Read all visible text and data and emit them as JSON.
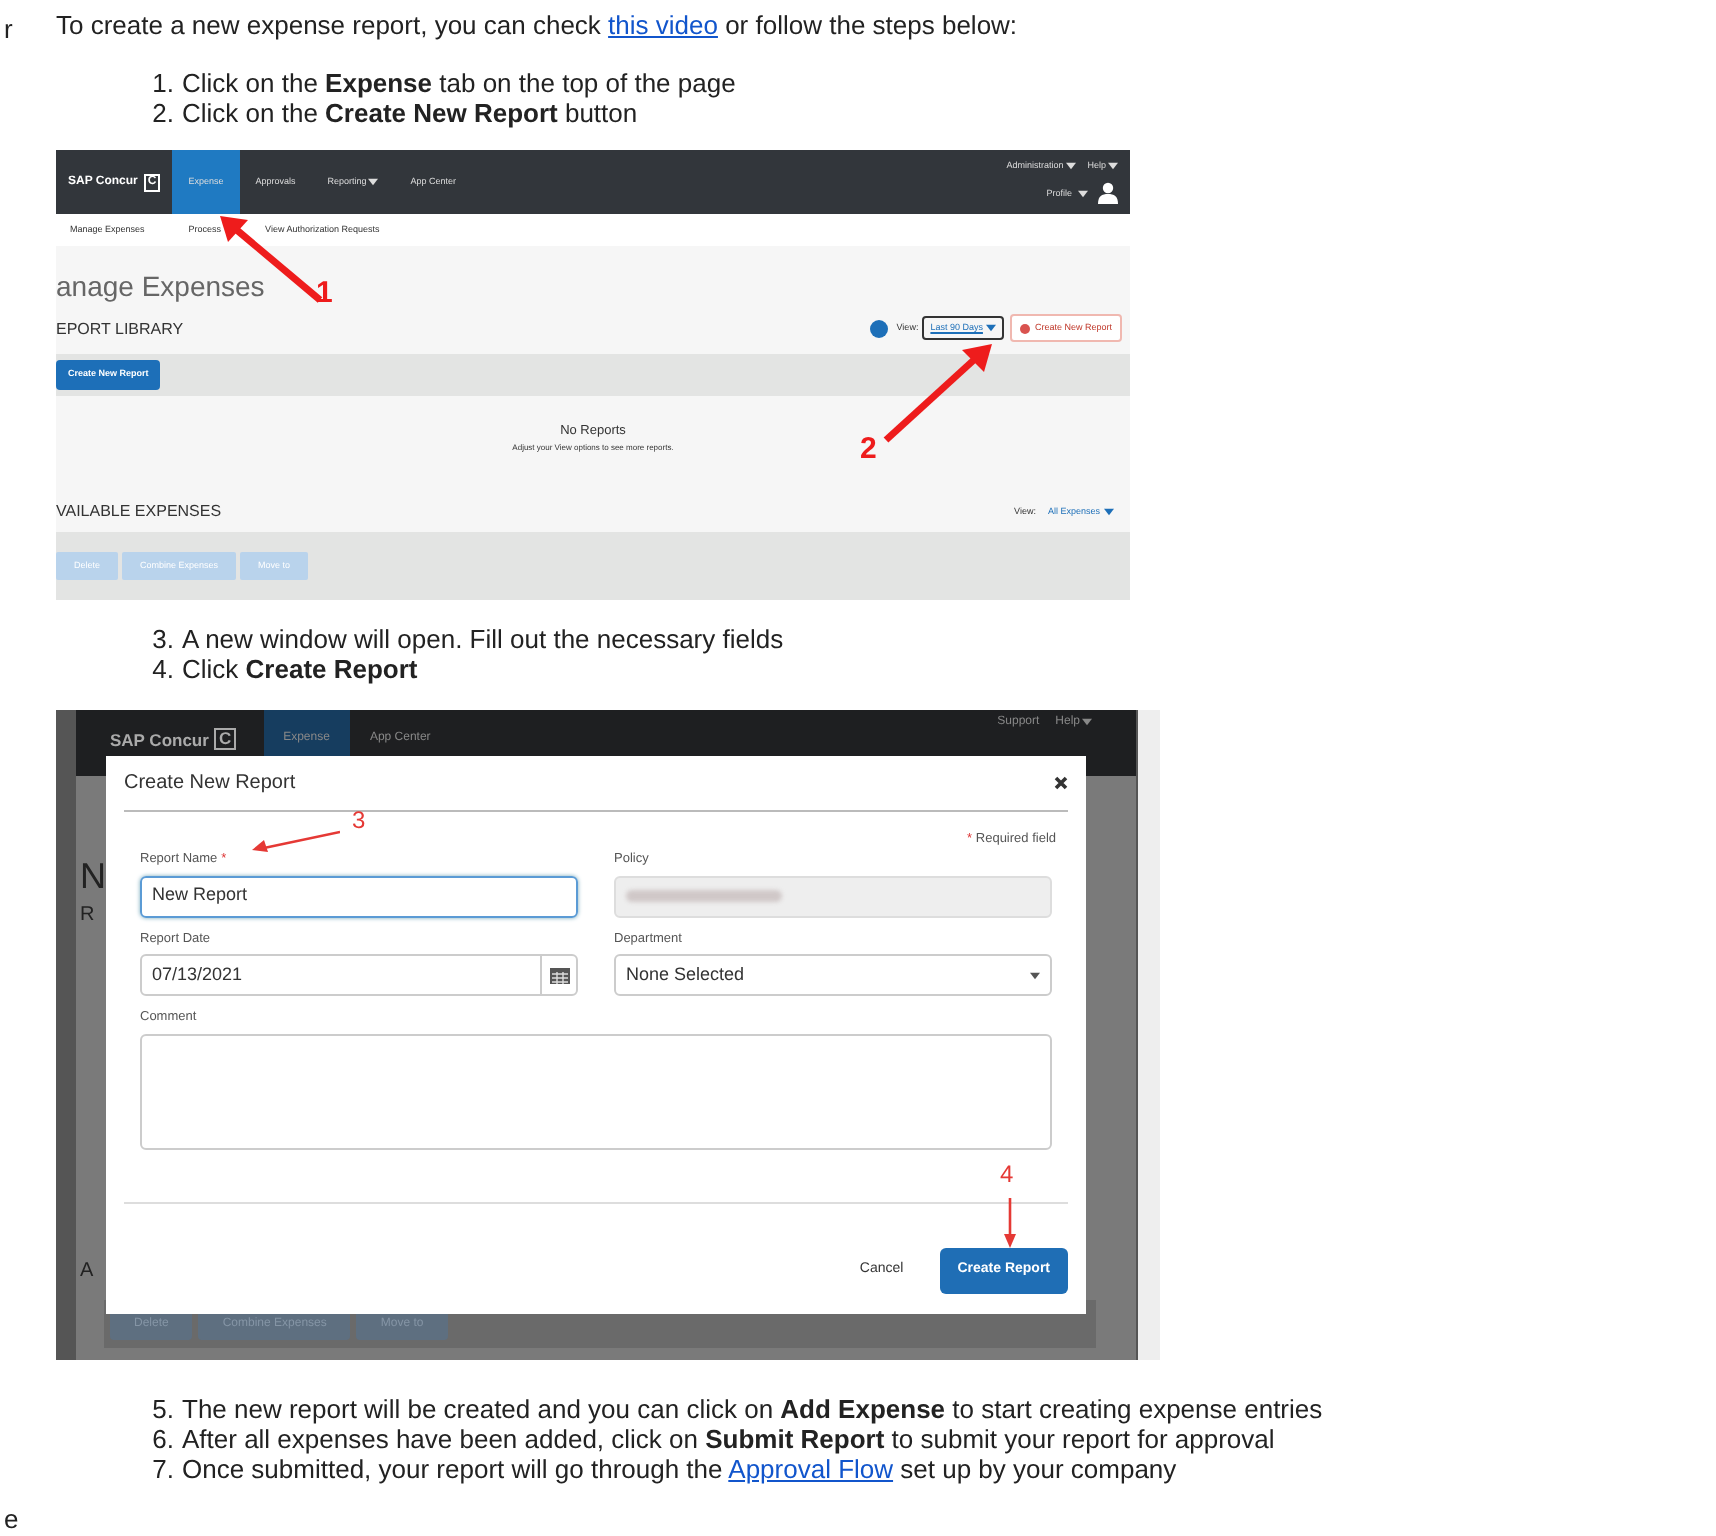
{
  "margin_fragments": [
    "r",
    "e"
  ],
  "intro": {
    "before": "To create a new expense report, you can check ",
    "link": "this video",
    "after": " or follow the steps below:"
  },
  "steps_a": [
    {
      "number": "1.",
      "text": "Click on the **Expense** tab on the top of the page"
    },
    {
      "number": "2.",
      "text": "Click on the **Create New Report** button"
    }
  ],
  "screenshot_1": {
    "logo": "SAP Concur",
    "logo_mark": "C",
    "tabs": [
      {
        "label": "Expense",
        "selected": true,
        "has_menu": false
      },
      {
        "label": "Approvals",
        "selected": false,
        "has_menu": false
      },
      {
        "label": "Reporting",
        "selected": false,
        "has_menu": true
      },
      {
        "label": "App Center",
        "selected": false,
        "has_menu": false
      }
    ],
    "top_links": [
      "Administration",
      "Help"
    ],
    "profile": "Profile",
    "subnav": [
      "Manage Expenses",
      "Process",
      "View Authorization Requests"
    ],
    "page_title": "anage Expenses",
    "section_1": "EPORT LIBRARY",
    "view_label": "View:",
    "view_value": "Last 90 Days",
    "create_link": "Create New Report",
    "create_button": "Create New Report",
    "empty_title": "No Reports",
    "empty_hint": "Adjust your View options to see more reports.",
    "section_2": "VAILABLE EXPENSES",
    "view2_label": "View:",
    "view2_value": "All Expenses",
    "actions": [
      "Delete",
      "Combine Expenses",
      "Move to"
    ],
    "annotations": [
      "1",
      "2"
    ]
  },
  "steps_b": [
    {
      "number": "3.",
      "text": "A new window will open. Fill out the necessary fields"
    },
    {
      "number": "4.",
      "text": "Click **Create Report**"
    }
  ],
  "screenshot_2": {
    "logo": "SAP Concur",
    "logo_mark": "C",
    "tabs": [
      {
        "label": "Expense",
        "selected": true
      },
      {
        "label": "App Center",
        "selected": false
      }
    ],
    "top_links": [
      "Support",
      "Help"
    ],
    "page_letters": [
      "N",
      "R",
      "A"
    ],
    "actions": [
      "Delete",
      "Combine Expenses",
      "Move to"
    ],
    "modal": {
      "title": "Create New Report",
      "required_symbol": "*",
      "required_note": "Required field",
      "fields": [
        {
          "kind": "text",
          "label": "Report Name",
          "required": true,
          "value": "New Report",
          "focused": true
        },
        {
          "kind": "blurred",
          "label": "Policy",
          "required": false
        },
        {
          "kind": "date",
          "label": "Report Date",
          "required": false,
          "value": "07/13/2021",
          "focused": false
        },
        {
          "kind": "select",
          "label": "Department",
          "required": false,
          "value": "None Selected"
        },
        {
          "kind": "textarea",
          "label": "Comment",
          "required": false
        }
      ],
      "cancel": "Cancel",
      "submit": "Create Report"
    },
    "annotations": [
      "3",
      "4"
    ]
  },
  "steps_c": [
    {
      "number": "5.",
      "text": "The new report will be created and you can click on **Add Expense** to start creating expense entries"
    },
    {
      "number": "6.",
      "text": "After all expenses have been added, click on **Submit Report** to submit your report for approval"
    },
    {
      "number": "7.",
      "text": "Once submitted, your report will go through the ",
      "link": "Approval Flow",
      "after": " set up by your company"
    }
  ]
}
